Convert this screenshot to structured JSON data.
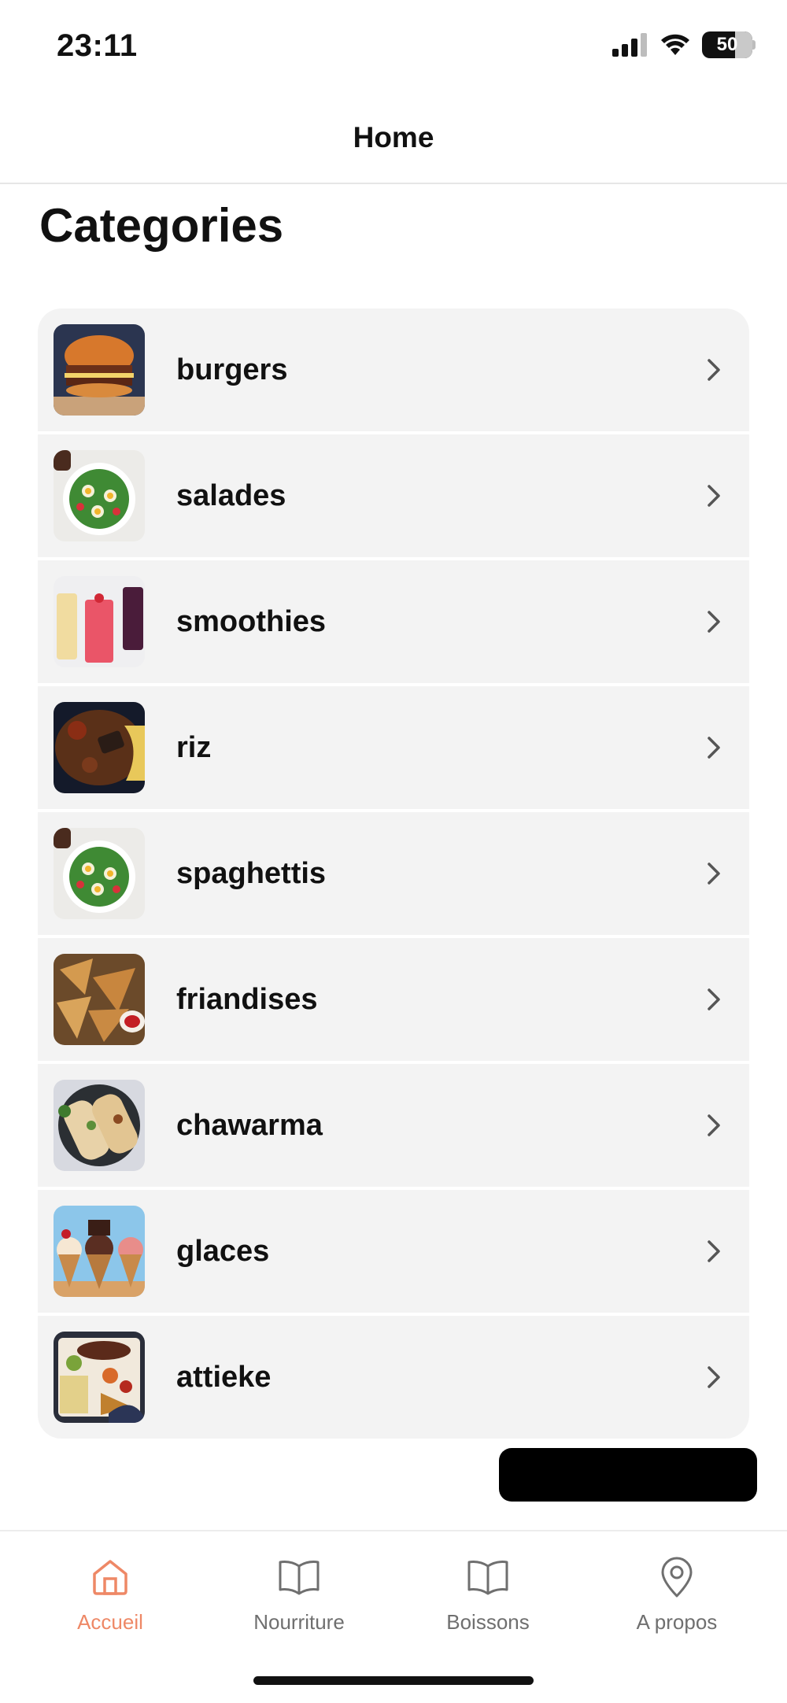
{
  "status_bar": {
    "time": "23:11",
    "battery": "50"
  },
  "header": {
    "title": "Home"
  },
  "section": {
    "title": "Categories"
  },
  "categories": [
    {
      "label": "burgers",
      "image": "burger-image"
    },
    {
      "label": "salades",
      "image": "salad-image"
    },
    {
      "label": "smoothies",
      "image": "smoothies-image"
    },
    {
      "label": "riz",
      "image": "rice-dish-image"
    },
    {
      "label": "spaghettis",
      "image": "salad-image"
    },
    {
      "label": "friandises",
      "image": "samosa-image"
    },
    {
      "label": "chawarma",
      "image": "wrap-image"
    },
    {
      "label": "glaces",
      "image": "ice-cream-image"
    },
    {
      "label": "attieke",
      "image": "platter-image"
    }
  ],
  "tabs": [
    {
      "label": "Accueil",
      "icon": "home-icon",
      "active": true
    },
    {
      "label": "Nourriture",
      "icon": "book-icon",
      "active": false
    },
    {
      "label": "Boissons",
      "icon": "book-icon",
      "active": false
    },
    {
      "label": "A propos",
      "icon": "location-pin-icon",
      "active": false
    }
  ],
  "colors": {
    "accent": "#ee8866",
    "row_background": "#f3f3f3",
    "tab_inactive": "#6f6f6f"
  }
}
